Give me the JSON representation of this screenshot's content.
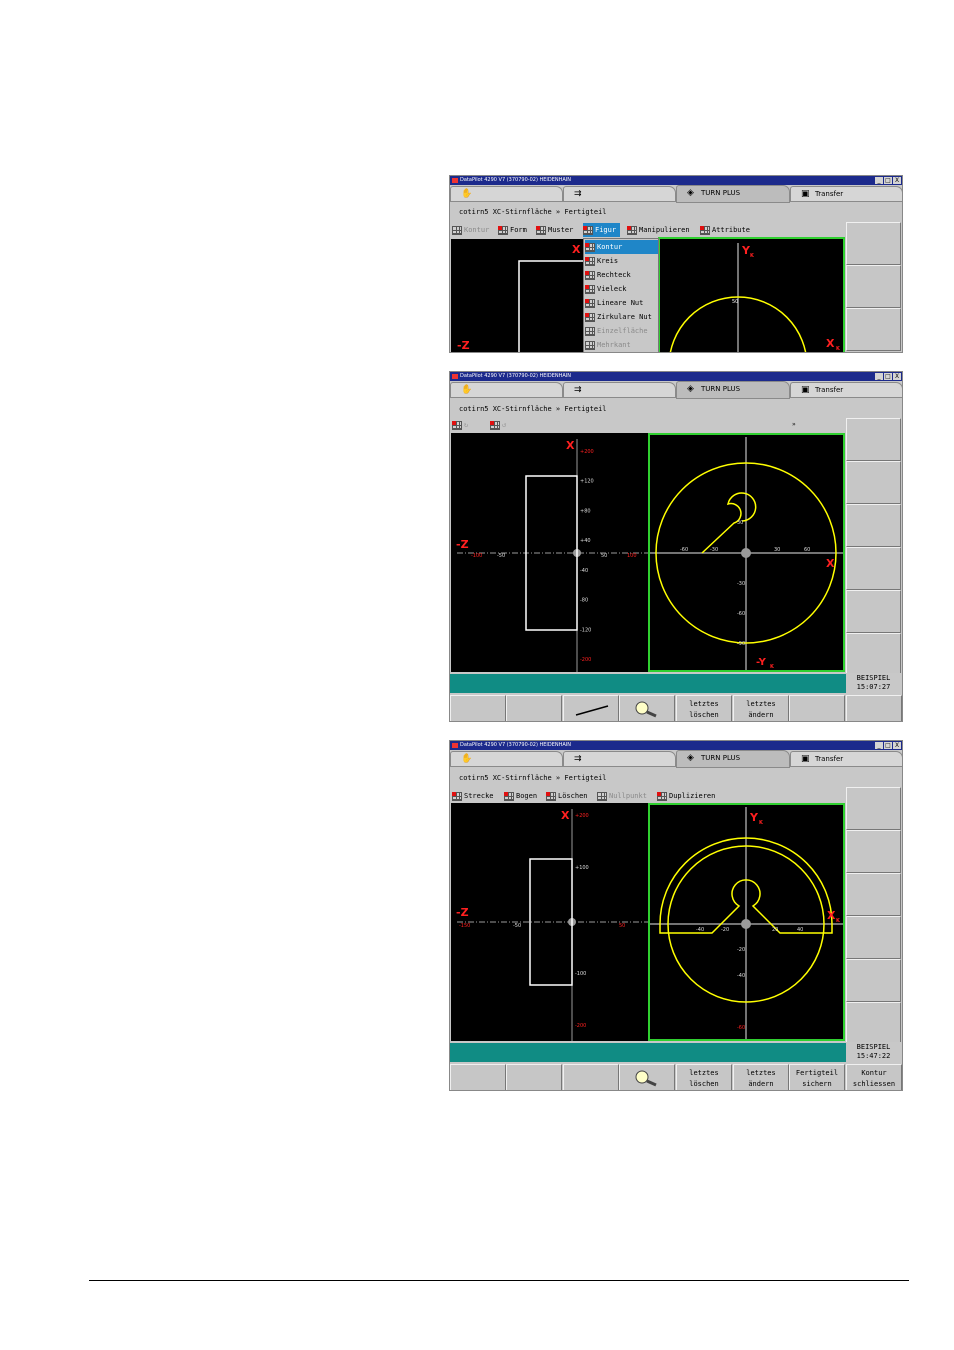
{
  "window_title": "DataPilot 4290 V7 (370790-02) HEIDENHAIN",
  "tabs": [
    {
      "label": "",
      "icon": "hand-icon"
    },
    {
      "label": "",
      "icon": "arrow-box-icon"
    },
    {
      "label": "TURN PLUS",
      "icon": "diamond-arrow-icon"
    },
    {
      "label": "Transfer",
      "icon": "floppy-disk-icon"
    }
  ],
  "window_buttons": [
    "_",
    "□",
    "X"
  ],
  "path": "cotirn5  XC-Stirnfläche » Fertigteil",
  "screen1": {
    "menu": [
      "Kontur",
      "Form",
      "Muster",
      "Figur",
      "Manipulieren",
      "Attribute"
    ],
    "dropdown": [
      "Kontur",
      "Kreis",
      "Rechteck",
      "Vieleck",
      "Lineare Nut",
      "Zirkulare Nut",
      "Einzelfläche",
      "Mehrkant"
    ],
    "left_labels": {
      "x": "X",
      "z": "-Z"
    },
    "right_labels": {
      "y": "Y",
      "x": "X",
      "sub": "K"
    },
    "tick": "50"
  },
  "screen2": {
    "toolbar_extra": "»",
    "left_labels": {
      "x": "X",
      "z": "-Z"
    },
    "right_labels": {
      "y": "-Y",
      "x": "X",
      "sub": "K"
    },
    "left_xticks": [
      "+200",
      "+120",
      "+80",
      "+40",
      "-40",
      "-80",
      "-120",
      "-200"
    ],
    "left_zticks": [
      "-100",
      "-50",
      "50",
      "100"
    ],
    "right_yticks": [
      "30",
      "-30",
      "-60",
      "-90"
    ],
    "right_xticks": [
      "-60",
      "-30",
      "30",
      "60"
    ],
    "clock_label": "BEISPIEL",
    "clock_time": "15:07:27",
    "softkeys": [
      "",
      "",
      "",
      "",
      "letztes löschen",
      "letztes ändern",
      "",
      ""
    ]
  },
  "screen3": {
    "menu": [
      "Strecke",
      "Bogen",
      "Löschen",
      "Nullpunkt",
      "Duplizieren"
    ],
    "left_labels": {
      "x": "X",
      "z": "-Z"
    },
    "right_labels": {
      "y": "Y",
      "x": "X",
      "sub": "K"
    },
    "left_xticks": [
      "+200",
      "+100",
      "-100",
      "-200"
    ],
    "left_zticks": [
      "-150",
      "-50",
      "50"
    ],
    "right_yticks": [
      "-20",
      "-40",
      "-60"
    ],
    "right_xticks": [
      "-40",
      "-20",
      "20",
      "40"
    ],
    "clock_label": "BEISPIEL",
    "clock_time": "15:47:22",
    "softkeys": [
      "",
      "",
      "",
      "",
      "letztes löschen",
      "letztes ändern",
      "Fertigteil sichern",
      "Kontur schliessen"
    ]
  },
  "colors": {
    "yellow": "#ffff00",
    "green_frame": "#30d030",
    "status": "#108c84",
    "title": "#1c2a8c",
    "axis_red": "#ff2020"
  }
}
